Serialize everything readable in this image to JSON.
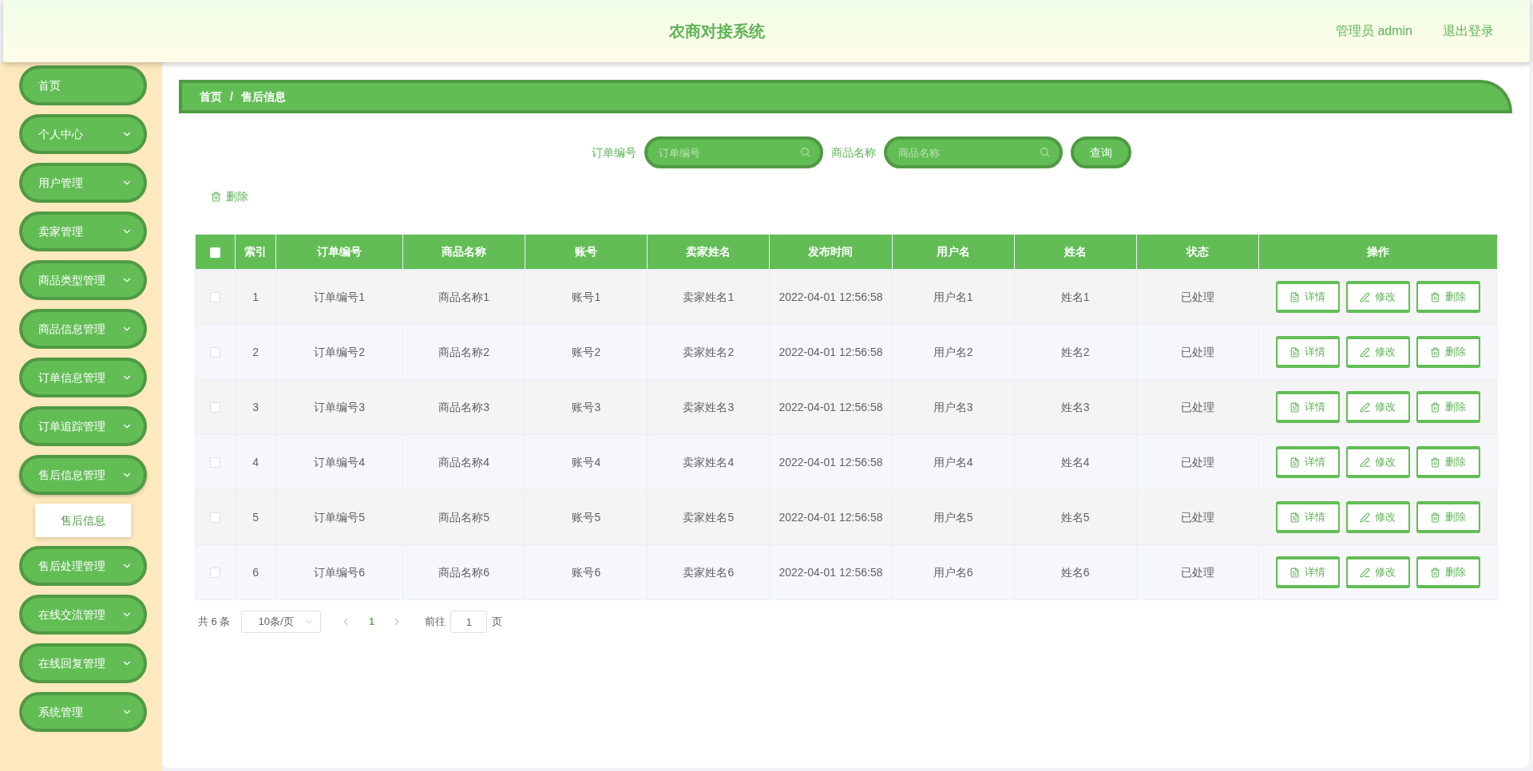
{
  "header": {
    "title": "农商对接系统",
    "user": "管理员 admin",
    "logout": "退出登录"
  },
  "sidebar": {
    "items": [
      {
        "label": "首页",
        "kind": "link",
        "expanded": false
      },
      {
        "label": "个人中心",
        "kind": "menu",
        "expanded": false
      },
      {
        "label": "用户管理",
        "kind": "menu",
        "expanded": false
      },
      {
        "label": "卖家管理",
        "kind": "menu",
        "expanded": false
      },
      {
        "label": "商品类型管理",
        "kind": "menu",
        "expanded": false
      },
      {
        "label": "商品信息管理",
        "kind": "menu",
        "expanded": false
      },
      {
        "label": "订单信息管理",
        "kind": "menu",
        "expanded": false
      },
      {
        "label": "订单追踪管理",
        "kind": "menu",
        "expanded": false
      },
      {
        "label": "售后信息管理",
        "kind": "menu",
        "expanded": true,
        "children": [
          {
            "label": "售后信息",
            "selected": true
          }
        ]
      },
      {
        "label": "售后处理管理",
        "kind": "menu",
        "expanded": false
      },
      {
        "label": "在线交流管理",
        "kind": "menu",
        "expanded": false
      },
      {
        "label": "在线回复管理",
        "kind": "menu",
        "expanded": false
      },
      {
        "label": "系统管理",
        "kind": "menu",
        "expanded": false
      }
    ]
  },
  "breadcrumb": [
    "首页",
    "售后信息"
  ],
  "breadcrumb_separator": "/",
  "search": {
    "fields": [
      {
        "label": "订单编号",
        "placeholder": "订单编号"
      },
      {
        "label": "商品名称",
        "placeholder": "商品名称"
      }
    ],
    "button": "查询"
  },
  "toolbar": {
    "delete": "删除"
  },
  "table": {
    "header_checked": false,
    "columns": [
      "索引",
      "订单编号",
      "商品名称",
      "账号",
      "卖家姓名",
      "发布时间",
      "用户名",
      "姓名",
      "状态",
      "操作"
    ],
    "rows": [
      {
        "checked": false,
        "cells": [
          "1",
          "订单编号1",
          "商品名称1",
          "账号1",
          "卖家姓名1",
          "2022-04-01 12:56:58",
          "用户名1",
          "姓名1",
          "已处理"
        ],
        "actions": [
          {
            "kind": "detail",
            "label": "详情"
          },
          {
            "kind": "edit",
            "label": "修改"
          },
          {
            "kind": "delete",
            "label": "删除"
          }
        ]
      },
      {
        "checked": false,
        "cells": [
          "2",
          "订单编号2",
          "商品名称2",
          "账号2",
          "卖家姓名2",
          "2022-04-01 12:56:58",
          "用户名2",
          "姓名2",
          "已处理"
        ],
        "actions": [
          {
            "kind": "detail",
            "label": "详情"
          },
          {
            "kind": "edit",
            "label": "修改"
          },
          {
            "kind": "delete",
            "label": "删除"
          }
        ]
      },
      {
        "checked": false,
        "cells": [
          "3",
          "订单编号3",
          "商品名称3",
          "账号3",
          "卖家姓名3",
          "2022-04-01 12:56:58",
          "用户名3",
          "姓名3",
          "已处理"
        ],
        "actions": [
          {
            "kind": "detail",
            "label": "详情"
          },
          {
            "kind": "edit",
            "label": "修改"
          },
          {
            "kind": "delete",
            "label": "删除"
          }
        ]
      },
      {
        "checked": false,
        "cells": [
          "4",
          "订单编号4",
          "商品名称4",
          "账号4",
          "卖家姓名4",
          "2022-04-01 12:56:58",
          "用户名4",
          "姓名4",
          "已处理"
        ],
        "actions": [
          {
            "kind": "detail",
            "label": "详情"
          },
          {
            "kind": "edit",
            "label": "修改"
          },
          {
            "kind": "delete",
            "label": "删除"
          }
        ]
      },
      {
        "checked": false,
        "cells": [
          "5",
          "订单编号5",
          "商品名称5",
          "账号5",
          "卖家姓名5",
          "2022-04-01 12:56:58",
          "用户名5",
          "姓名5",
          "已处理"
        ],
        "actions": [
          {
            "kind": "detail",
            "label": "详情"
          },
          {
            "kind": "edit",
            "label": "修改"
          },
          {
            "kind": "delete",
            "label": "删除"
          }
        ]
      },
      {
        "checked": false,
        "cells": [
          "6",
          "订单编号6",
          "商品名称6",
          "账号6",
          "卖家姓名6",
          "2022-04-01 12:56:58",
          "用户名6",
          "姓名6",
          "已处理"
        ],
        "actions": [
          {
            "kind": "detail",
            "label": "详情"
          },
          {
            "kind": "edit",
            "label": "修改"
          },
          {
            "kind": "delete",
            "label": "删除"
          }
        ]
      }
    ]
  },
  "pagination": {
    "total": "共 6 条",
    "page_size": "10条/页",
    "pages": [
      {
        "label": "1",
        "selected": true
      }
    ],
    "goto_label": "前往",
    "goto_value": "1",
    "goto_suffix": "页"
  }
}
